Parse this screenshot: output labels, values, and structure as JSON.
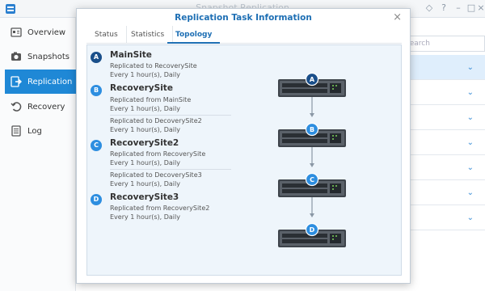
{
  "app": {
    "title": "Snapshot Replication",
    "search_placeholder": "Search"
  },
  "sidebar": {
    "items": [
      {
        "label": "Overview",
        "icon": "overview-icon"
      },
      {
        "label": "Snapshots",
        "icon": "camera-icon"
      },
      {
        "label": "Replication",
        "icon": "replication-icon"
      },
      {
        "label": "Recovery",
        "icon": "recovery-icon"
      },
      {
        "label": "Log",
        "icon": "log-icon"
      }
    ],
    "active": "Replication"
  },
  "modal": {
    "title": "Replication Task Information",
    "tabs": [
      {
        "label": "Status"
      },
      {
        "label": "Statistics"
      },
      {
        "label": "Topology"
      }
    ],
    "active_tab": "Topology"
  },
  "sites": [
    {
      "badge": "A",
      "name": "MainSite",
      "lines": [
        "Replicated to RecoverySite",
        "Every 1 hour(s), Daily"
      ]
    },
    {
      "badge": "B",
      "name": "RecoverySite",
      "lines": [
        "Replicated from MainSite",
        "Every 1 hour(s), Daily",
        "Replicated to DecoverySite2",
        "Every 1 hour(s), Daily"
      ]
    },
    {
      "badge": "C",
      "name": "RecoverySite2",
      "lines": [
        "Replicated from RecoverySite",
        "Every 1 hour(s), Daily",
        "Replicated to DecoverySite3",
        "Every 1 hour(s), Daily"
      ]
    },
    {
      "badge": "D",
      "name": "RecoverySite3",
      "lines": [
        "Replicated from RecoverySite2",
        "Every 1 hour(s), Daily"
      ]
    }
  ],
  "colors": {
    "accent": "#1f88d6",
    "badge_dark": "#1a4f8a",
    "badge_light": "#2d8ee0",
    "panel_bg": "#eef5fb"
  }
}
